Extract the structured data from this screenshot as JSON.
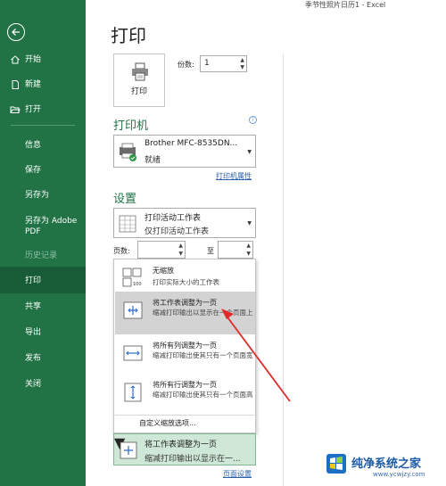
{
  "window": {
    "title": "季节性照片日历1  -  Excel"
  },
  "sidebar": {
    "items": [
      {
        "label": "开始",
        "icon": "home-icon"
      },
      {
        "label": "新建",
        "icon": "new-doc-icon"
      },
      {
        "label": "打开",
        "icon": "open-folder-icon"
      },
      {
        "label": "信息"
      },
      {
        "label": "保存"
      },
      {
        "label": "另存为"
      },
      {
        "label": "另存为 Adobe PDF"
      },
      {
        "label": "历史记录"
      },
      {
        "label": "打印"
      },
      {
        "label": "共享"
      },
      {
        "label": "导出"
      },
      {
        "label": "发布"
      },
      {
        "label": "关闭"
      }
    ],
    "active": "打印"
  },
  "page": {
    "title": "打印"
  },
  "print": {
    "button_label": "打印",
    "copies_label": "份数:",
    "copies_value": "1"
  },
  "printer": {
    "section_title": "打印机",
    "name": "Brother MFC-8535DN...",
    "status": "就绪",
    "properties_link": "打印机属性"
  },
  "settings": {
    "section_title": "设置",
    "scope": {
      "line1": "打印活动工作表",
      "line2": "仅打印活动工作表"
    },
    "pages_label": "页数:",
    "to_label": "至"
  },
  "scaling_menu": {
    "items": [
      {
        "title": "无缩放",
        "desc": "打印实际大小的工作表"
      },
      {
        "title": "将工作表调整为一页",
        "desc": "缩减打印输出以显示在一个页面上"
      },
      {
        "title": "将所有列调整为一页",
        "desc": "缩减打印输出使其只有一个页面宽"
      },
      {
        "title": "将所有行调整为一页",
        "desc": "缩减打印输出使其只有一个页面高"
      }
    ],
    "custom": "自定义缩放选项...",
    "highlighted_index": 1
  },
  "scaling_select": {
    "line1": "将工作表调整为一页",
    "line2": "缩减打印输出以显示在一..."
  },
  "page_setup_link": "页面设置",
  "watermark": {
    "title": "纯净系统之家",
    "url": "www.ycwjzy.com"
  },
  "colors": {
    "brand": "#217346",
    "active_nav": "#185c37",
    "annotation": "#e02a2a"
  }
}
